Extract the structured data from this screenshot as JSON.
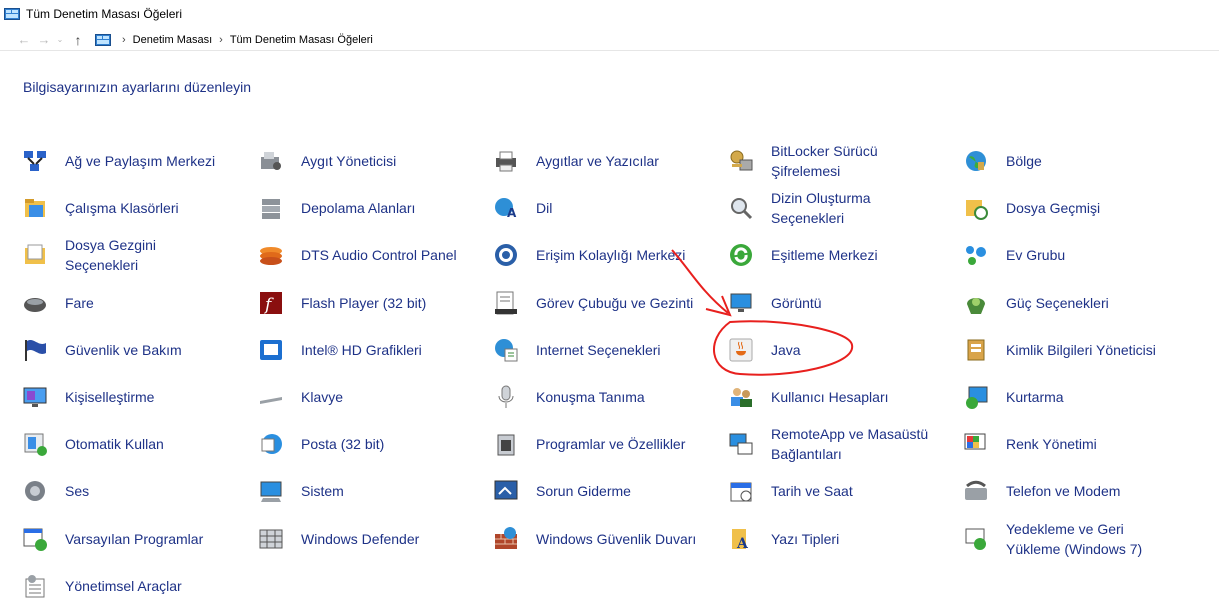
{
  "window": {
    "title": "Tüm Denetim Masası Öğeleri"
  },
  "nav": {
    "back": "←",
    "forward": "→",
    "recent": "⌄",
    "up": "↑",
    "breadcrumb": [
      "Denetim Masası",
      "Tüm Denetim Masası Öğeleri"
    ],
    "separator": "›"
  },
  "heading": "Bilgisayarınızın ayarlarını düzenleyin",
  "items": [
    {
      "label": "Ağ ve Paylaşım Merkezi",
      "icon": "network-icon"
    },
    {
      "label": "Aygıt Yöneticisi",
      "icon": "device-manager-icon"
    },
    {
      "label": "Aygıtlar ve Yazıcılar",
      "icon": "printer-icon"
    },
    {
      "label": "BitLocker Sürücü Şifrelemesi",
      "icon": "bitlocker-icon"
    },
    {
      "label": "Bölge",
      "icon": "globe-icon"
    },
    {
      "label": "Çalışma Klasörleri",
      "icon": "work-folders-icon"
    },
    {
      "label": "Depolama Alanları",
      "icon": "storage-icon"
    },
    {
      "label": "Dil",
      "icon": "language-icon"
    },
    {
      "label": "Dizin Oluşturma Seçenekleri",
      "icon": "indexing-icon"
    },
    {
      "label": "Dosya Geçmişi",
      "icon": "file-history-icon"
    },
    {
      "label": "Dosya Gezgini Seçenekleri",
      "icon": "folder-options-icon"
    },
    {
      "label": "DTS Audio Control Panel",
      "icon": "dts-audio-icon"
    },
    {
      "label": "Erişim Kolaylığı Merkezi",
      "icon": "accessibility-icon"
    },
    {
      "label": "Eşitleme Merkezi",
      "icon": "sync-icon"
    },
    {
      "label": "Ev Grubu",
      "icon": "homegroup-icon"
    },
    {
      "label": "Fare",
      "icon": "mouse-icon"
    },
    {
      "label": "Flash Player (32 bit)",
      "icon": "flash-icon"
    },
    {
      "label": "Görev Çubuğu ve Gezinti",
      "icon": "taskbar-icon"
    },
    {
      "label": "Görüntü",
      "icon": "display-icon"
    },
    {
      "label": "Güç Seçenekleri",
      "icon": "power-icon"
    },
    {
      "label": "Güvenlik ve Bakım",
      "icon": "flag-icon"
    },
    {
      "label": "Intel® HD Grafikleri",
      "icon": "intel-graphics-icon"
    },
    {
      "label": "Internet Seçenekleri",
      "icon": "internet-options-icon"
    },
    {
      "label": "Java",
      "icon": "java-icon"
    },
    {
      "label": "Kimlik Bilgileri Yöneticisi",
      "icon": "credential-icon"
    },
    {
      "label": "Kişiselleştirme",
      "icon": "personalization-icon"
    },
    {
      "label": "Klavye",
      "icon": "keyboard-icon"
    },
    {
      "label": "Konuşma Tanıma",
      "icon": "microphone-icon"
    },
    {
      "label": "Kullanıcı Hesapları",
      "icon": "users-icon"
    },
    {
      "label": "Kurtarma",
      "icon": "recovery-icon"
    },
    {
      "label": "Otomatik Kullan",
      "icon": "autoplay-icon"
    },
    {
      "label": "Posta (32 bit)",
      "icon": "mail-icon"
    },
    {
      "label": "Programlar ve Özellikler",
      "icon": "programs-icon"
    },
    {
      "label": "RemoteApp ve Masaüstü Bağlantıları",
      "icon": "remoteapp-icon"
    },
    {
      "label": "Renk Yönetimi",
      "icon": "color-management-icon"
    },
    {
      "label": "Ses",
      "icon": "speaker-icon"
    },
    {
      "label": "Sistem",
      "icon": "system-icon"
    },
    {
      "label": "Sorun Giderme",
      "icon": "troubleshoot-icon"
    },
    {
      "label": "Tarih ve Saat",
      "icon": "calendar-icon"
    },
    {
      "label": "Telefon ve Modem",
      "icon": "phone-icon"
    },
    {
      "label": "Varsayılan Programlar",
      "icon": "default-programs-icon"
    },
    {
      "label": "Windows Defender",
      "icon": "defender-icon"
    },
    {
      "label": "Windows Güvenlik Duvarı",
      "icon": "firewall-icon"
    },
    {
      "label": "Yazı Tipleri",
      "icon": "fonts-icon"
    },
    {
      "label": "Yedekleme ve Geri Yükleme (Windows 7)",
      "icon": "backup-icon"
    },
    {
      "label": "Yönetimsel Araçlar",
      "icon": "admin-tools-icon"
    }
  ],
  "colors": {
    "link": "#1e3287",
    "annotation": "#e8201e"
  }
}
